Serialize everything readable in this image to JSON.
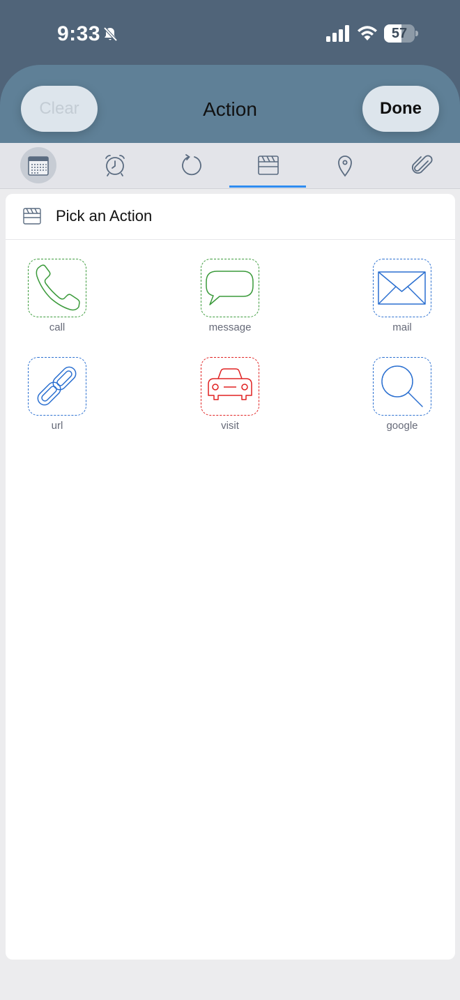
{
  "status_bar": {
    "time": "9:33",
    "battery": "57",
    "battery_level": 0.57,
    "icons": [
      "bell-slash-icon",
      "signal-icon",
      "wifi-icon",
      "battery-icon"
    ]
  },
  "header": {
    "title": "Action",
    "clear_label": "Clear",
    "done_label": "Done"
  },
  "tabs": [
    {
      "icon": "calendar-icon",
      "selected_circle": true
    },
    {
      "icon": "alarm-clock-icon"
    },
    {
      "icon": "repeat-icon"
    },
    {
      "icon": "clapperboard-icon",
      "active": true
    },
    {
      "icon": "location-pin-icon"
    },
    {
      "icon": "paperclip-icon"
    }
  ],
  "card": {
    "icon": "clapperboard-icon",
    "title": "Pick an Action"
  },
  "actions": [
    {
      "label": "call",
      "icon": "phone-icon",
      "color": "#3a9a3a"
    },
    {
      "label": "message",
      "icon": "speech-bubble-icon",
      "color": "#3a9a3a"
    },
    {
      "label": "mail",
      "icon": "envelope-icon",
      "color": "#2a6fd0"
    },
    {
      "label": "url",
      "icon": "link-icon",
      "color": "#2a6fd0"
    },
    {
      "label": "visit",
      "icon": "car-icon",
      "color": "#e02020"
    },
    {
      "label": "google",
      "icon": "magnifier-icon",
      "color": "#2a6fd0"
    }
  ],
  "colors": {
    "accent": "#2f8cf0",
    "status_bg": "#506479",
    "header_bg": "#5f8097"
  }
}
